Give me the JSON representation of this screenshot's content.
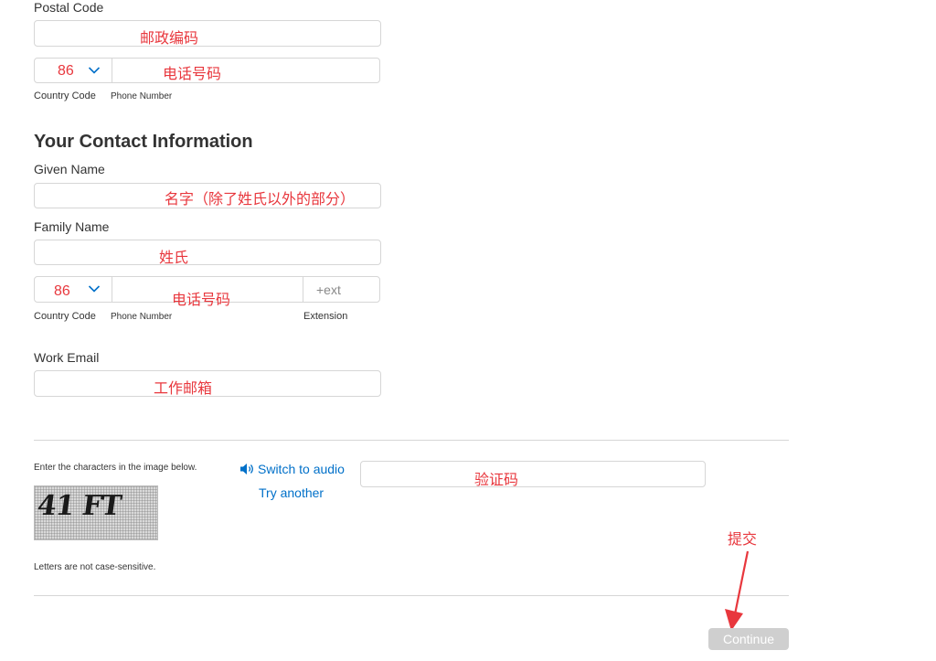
{
  "postal": {
    "label": "Postal Code",
    "note": "邮政编码"
  },
  "company_phone": {
    "country_code": "86",
    "note": "电话号码",
    "country_code_label": "Country Code",
    "phone_number_label": "Phone Number"
  },
  "contact": {
    "heading": "Your Contact Information",
    "given_name_label": "Given Name",
    "given_name_note": "名字（除了姓氏以外的部分）",
    "family_name_label": "Family Name",
    "family_name_note": "姓氏",
    "phone": {
      "country_code": "86",
      "note": "电话号码",
      "ext_placeholder": "+ext",
      "country_code_label": "Country Code",
      "phone_number_label": "Phone Number",
      "extension_label": "Extension"
    },
    "work_email_label": "Work Email",
    "work_email_note": "工作邮箱"
  },
  "captcha": {
    "instruction": "Enter the characters in the image below.",
    "switch_audio": "Switch to audio",
    "try_another": "Try another",
    "image_text": "41 FT",
    "note": "验证码",
    "case_note": "Letters are not case-sensitive."
  },
  "annotation": {
    "submit_note": "提交",
    "color": "#e8373d"
  },
  "continue_label": "Continue",
  "icons": {
    "chevron": "chevron-down-icon",
    "speaker": "speaker-icon",
    "arrow": "red-arrow-annotation"
  }
}
